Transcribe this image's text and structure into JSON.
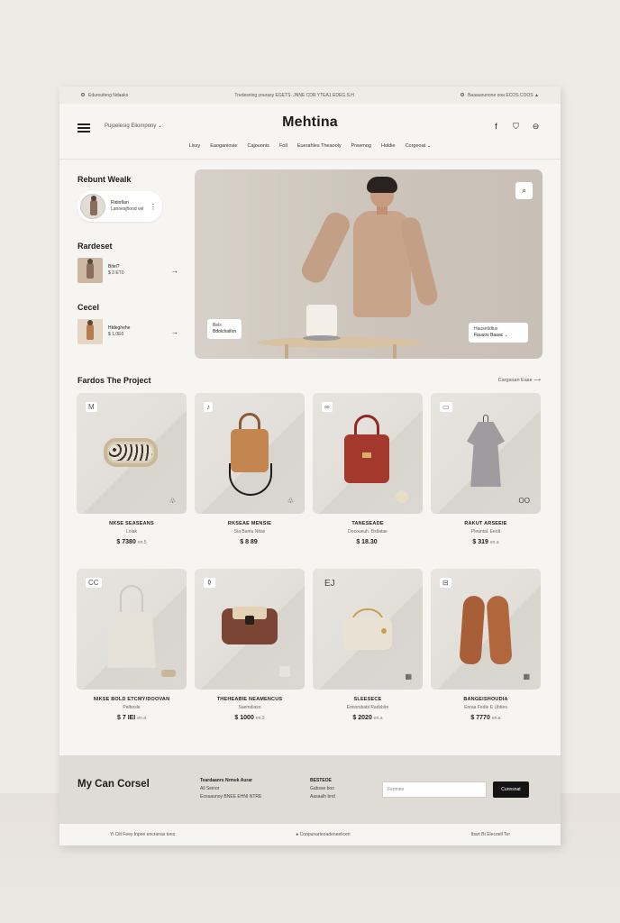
{
  "topbar": {
    "left": "Eduroufeng Ndaaks",
    "center": "Tredesning yourasy EGETS. JNNE CDR YTEA1 EDEG.S.H",
    "right": "Baaauounone ooa ECOS COOS"
  },
  "header": {
    "brand": "Mehtina",
    "language": "Pujoelesig Eliompony",
    "nav": [
      "Lissy",
      "Eaoganiovie",
      "Cajouonis",
      "Foll",
      "Euerahles Theaooly",
      "Preemog",
      "Holdie",
      "Corgeoat"
    ]
  },
  "sidebar": {
    "sections": [
      {
        "title": "Rebunt Wealk",
        "line1": "Ridorllan",
        "line2": "Lannesjhond vel",
        "style": "pill"
      },
      {
        "title": "Rardeset",
        "line1": "Bitel?",
        "line2": "$ 3 ET0",
        "style": "card"
      },
      {
        "title": "Cecel",
        "line1": "Htdeghehe",
        "line2": "$ 1,0E0",
        "style": "card"
      }
    ]
  },
  "hero": {
    "tag_left_small": "Bels",
    "tag_left": "Bdolchaifon",
    "tag_right_small": "Hausetidtus",
    "tag_right": "Fauuov Baaac"
  },
  "featured": {
    "title": "Fardos The Project",
    "category_link": "Cargsoan Ease"
  },
  "products": [
    {
      "name": "NKSE SEASEANS",
      "sub": "Lolak",
      "price": "$ 7380",
      "note": "en.5",
      "badge": "M"
    },
    {
      "name": "RKSEAE MENSIE",
      "sub": "Sia Bantu Nitas",
      "price": "$ 8 89",
      "note": "",
      "badge": "♪"
    },
    {
      "name": "TANESEADE",
      "sub": "Docoueuh. Bstlatae",
      "price": "$ 18.30",
      "note": "",
      "badge": "∞"
    },
    {
      "name": "RAKUT ARSEEIE",
      "sub": "Pleuntal. Eeolt",
      "price": "$ 319",
      "note": "en.a",
      "badge": "▭"
    },
    {
      "name": "NIKSE BOLD ETCMY/DOOVAN",
      "sub": "Pelbosle",
      "price": "$ 7 IEI",
      "note": "en.a",
      "badge": "CC"
    },
    {
      "name": "THEHEABIE NEAMENCUS",
      "sub": "Saemdiaso",
      "price": "$ 1000",
      "note": "en.3",
      "badge": "⚱"
    },
    {
      "name": "SLEESECE",
      "sub": "Eonorsbabi Radsblre",
      "price": "$ 2020",
      "note": "en.a",
      "badge": "EJ"
    },
    {
      "name": "BANGEISHOUDIA",
      "sub": "Eoraa Fedle E Ubtieo",
      "price": "$ 7770",
      "note": "en.a",
      "badge": "⊟"
    }
  ],
  "footer": {
    "title": "My Can Corsel",
    "col1_head": "Teardaanrs Nrmek Aurar",
    "col1_lines": [
      "All Seinor",
      "Eosuaunoy BNEE EHNI NTRE"
    ],
    "col2_head": "BESTEOE",
    "col2_lines": [
      "Gabsse boo",
      "Aasaalh bnd"
    ],
    "email_placeholder": "Fenmeo",
    "subscribe": "Cunnsnat",
    "bottom_left": "Yi Cilt Feey Inpee encranas tons",
    "bottom_center": "Conpunarteoadeneeliceri",
    "bottom_right": "Ibart Bt Elecoell Ter"
  }
}
